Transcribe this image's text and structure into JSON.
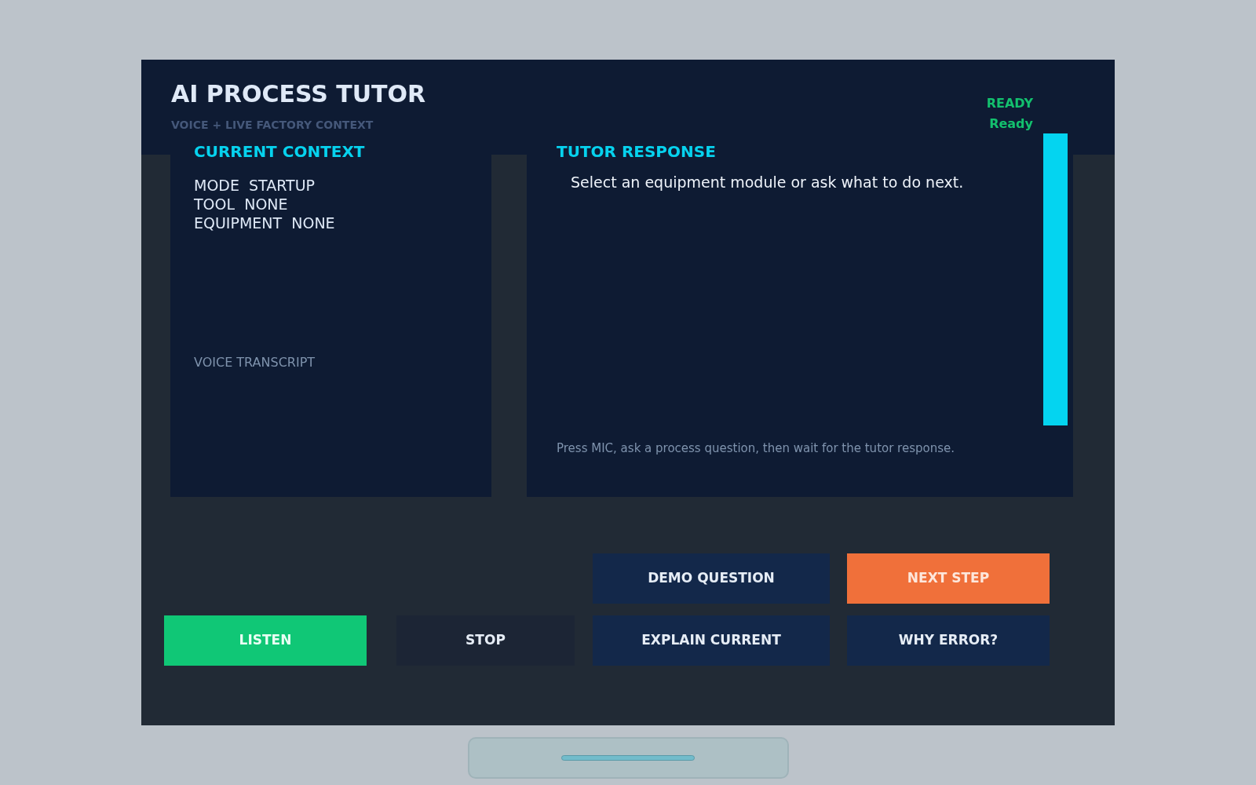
{
  "header": {
    "title": "AI PROCESS TUTOR",
    "subtitle": "VOICE + LIVE FACTORY CONTEXT",
    "status": "READY",
    "status_detail": "Ready"
  },
  "context_panel": {
    "title": "CURRENT CONTEXT",
    "lines": [
      "MODE  STARTUP",
      "TOOL  NONE",
      "EQUIPMENT  NONE"
    ],
    "transcript_label": "VOICE TRANSCRIPT"
  },
  "response_panel": {
    "title": "TUTOR RESPONSE",
    "response": "Select an equipment module or ask what to do next.",
    "hint": "Press MIC, ask a process question, then wait for the tutor response."
  },
  "button_rows": [
    [
      {
        "label": "DEMO QUESTION",
        "kind": "action"
      },
      {
        "label": "NEXT STEP",
        "kind": "highlight"
      }
    ],
    [
      {
        "label": "LISTEN",
        "kind": "go"
      },
      {
        "label": "STOP",
        "kind": "stop"
      },
      {
        "label": "EXPLAIN CURRENT",
        "kind": "action"
      },
      {
        "label": "WHY ERROR?",
        "kind": "action"
      }
    ]
  ]
}
